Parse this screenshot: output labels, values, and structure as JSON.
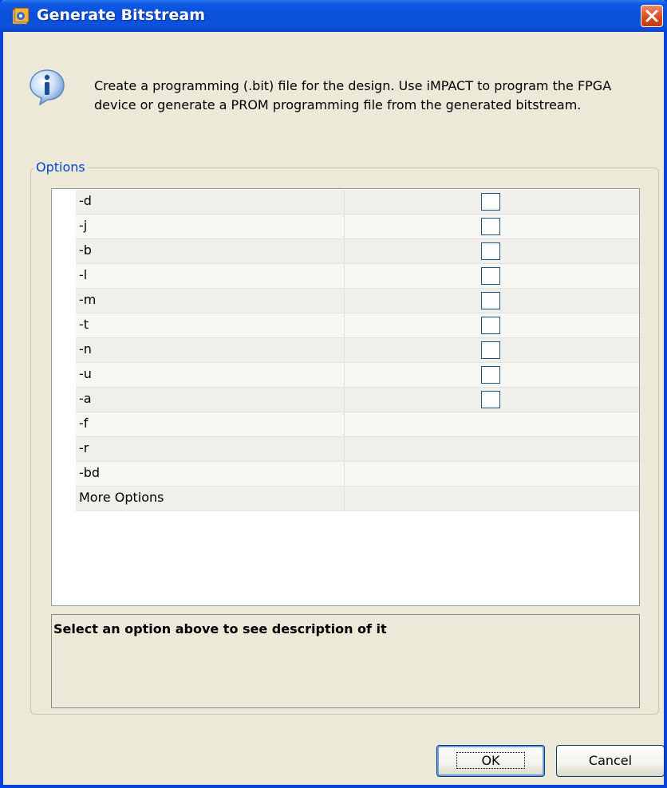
{
  "window": {
    "title": "Generate Bitstream",
    "icon": "app-icon",
    "close_icon": "close-icon"
  },
  "info": {
    "icon": "info-icon",
    "text": "Create a programming (.bit) file for the design. Use iMPACT to program the FPGA device or generate a PROM programming file from the generated bitstream."
  },
  "options": {
    "label": "Options",
    "rows": [
      {
        "name": "-d",
        "has_checkbox": true,
        "checked": false
      },
      {
        "name": "-j",
        "has_checkbox": true,
        "checked": false
      },
      {
        "name": "-b",
        "has_checkbox": true,
        "checked": false
      },
      {
        "name": "-l",
        "has_checkbox": true,
        "checked": false
      },
      {
        "name": "-m",
        "has_checkbox": true,
        "checked": false
      },
      {
        "name": "-t",
        "has_checkbox": true,
        "checked": false
      },
      {
        "name": "-n",
        "has_checkbox": true,
        "checked": false
      },
      {
        "name": "-u",
        "has_checkbox": true,
        "checked": false
      },
      {
        "name": "-a",
        "has_checkbox": true,
        "checked": false
      },
      {
        "name": "-f",
        "has_checkbox": false,
        "checked": false
      },
      {
        "name": "-r",
        "has_checkbox": false,
        "checked": false
      },
      {
        "name": "-bd",
        "has_checkbox": false,
        "checked": false
      },
      {
        "name": "More Options",
        "has_checkbox": false,
        "checked": false
      }
    ]
  },
  "description": {
    "text": "Select an option above to see description of it"
  },
  "buttons": {
    "ok_label": "OK",
    "cancel_label": "Cancel"
  },
  "colors": {
    "titlebar": "#0a4fd8",
    "dialog_bg": "#ece9d8",
    "group_label": "#0046d5",
    "checkbox_border": "#1c5180"
  }
}
